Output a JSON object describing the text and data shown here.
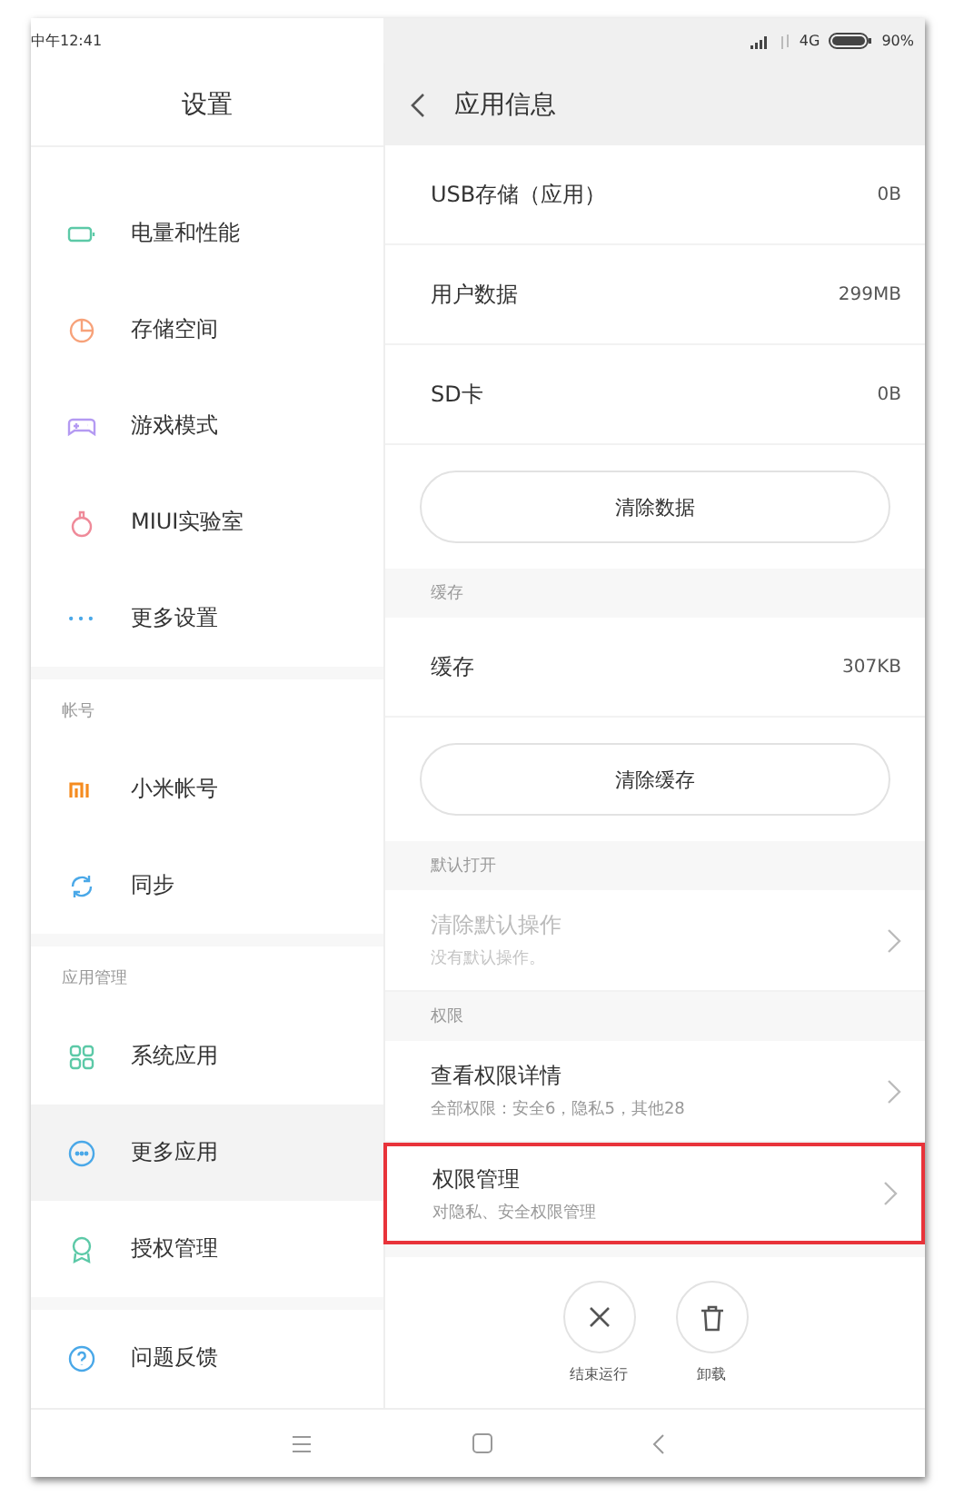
{
  "status_bar": {
    "time": "中午12:41",
    "network": "4G",
    "battery": "90%"
  },
  "settings": {
    "title": "设置",
    "sections": [
      {
        "items": [
          {
            "label": "电量和性能",
            "selected": false
          },
          {
            "label": "存储空间",
            "selected": false
          },
          {
            "label": "游戏模式",
            "selected": false
          },
          {
            "label": "MIUI实验室",
            "selected": false
          },
          {
            "label": "更多设置",
            "selected": false
          }
        ]
      },
      {
        "label": "帐号",
        "items": [
          {
            "label": "小米帐号",
            "selected": false
          },
          {
            "label": "同步",
            "selected": false
          }
        ]
      },
      {
        "label": "应用管理",
        "items": [
          {
            "label": "系统应用",
            "selected": false
          },
          {
            "label": "更多应用",
            "selected": true
          },
          {
            "label": "授权管理",
            "selected": false
          }
        ]
      },
      {
        "items": [
          {
            "label": "问题反馈",
            "selected": false
          }
        ]
      }
    ]
  },
  "app_info": {
    "title": "应用信息",
    "items": [
      {
        "kind": "row",
        "label": "USB存储（应用）",
        "value": "0B"
      },
      {
        "kind": "row",
        "label": "用户数据",
        "value": "299MB"
      },
      {
        "kind": "row",
        "label": "SD卡",
        "value": "0B"
      },
      {
        "kind": "button",
        "label": "清除数据"
      },
      {
        "kind": "section",
        "label": "缓存"
      },
      {
        "kind": "row",
        "label": "缓存",
        "value": "307KB"
      },
      {
        "kind": "button",
        "label": "清除缓存"
      },
      {
        "kind": "section",
        "label": "默认打开"
      },
      {
        "kind": "link",
        "label": "清除默认操作",
        "sub": "没有默认操作。",
        "disabled": true,
        "highlighted": false
      },
      {
        "kind": "section",
        "label": "权限"
      },
      {
        "kind": "link",
        "label": "查看权限详情",
        "sub": "全部权限：安全6，隐私5，其他28",
        "disabled": false,
        "highlighted": false
      },
      {
        "kind": "link",
        "label": "权限管理",
        "sub": "对隐私、安全权限管理",
        "disabled": false,
        "highlighted": true
      }
    ],
    "actions": [
      {
        "label": "结束运行"
      },
      {
        "label": "卸载"
      }
    ]
  }
}
